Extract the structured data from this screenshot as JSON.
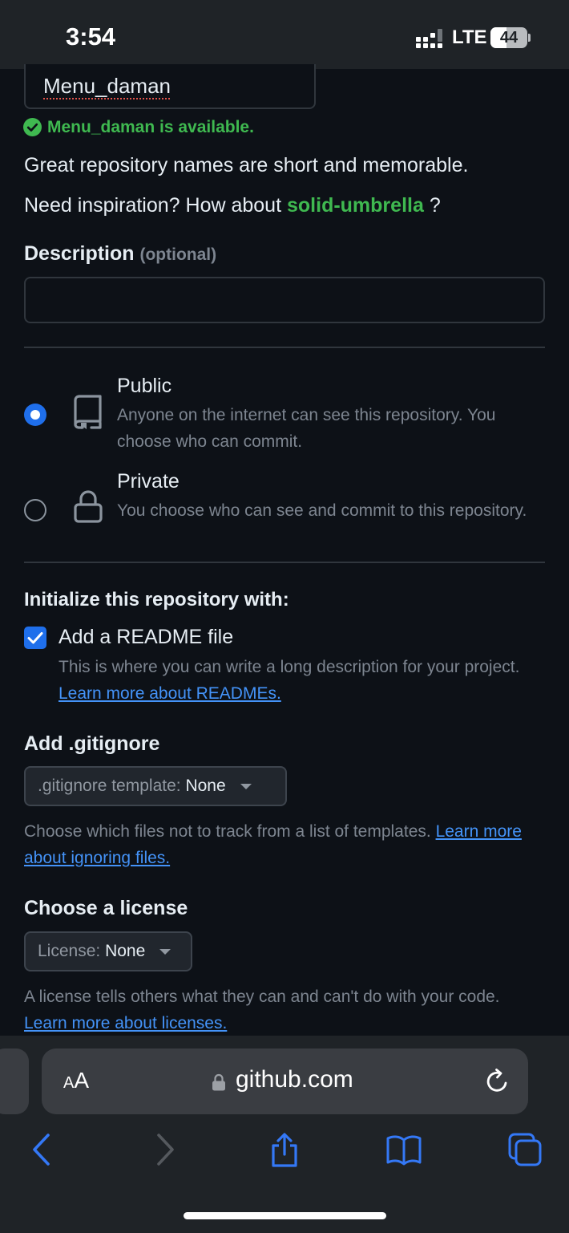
{
  "status_bar": {
    "time": "3:54",
    "network": "LTE",
    "battery": "44"
  },
  "repo_name": {
    "value": "Menu_daman",
    "availability": "Menu_daman is available."
  },
  "hints": {
    "short_memorable": "Great repository names are short and memorable.",
    "inspiration_prefix": "Need inspiration? How about",
    "suggestion": "solid-umbrella",
    "inspiration_suffix": "?"
  },
  "description": {
    "label": "Description",
    "optional": "(optional)",
    "value": ""
  },
  "visibility": {
    "selected": "public",
    "public": {
      "title": "Public",
      "desc": "Anyone on the internet can see this repository. You choose who can commit."
    },
    "private": {
      "title": "Private",
      "desc": "You choose who can see and commit to this repository."
    }
  },
  "initialize": {
    "heading": "Initialize this repository with:",
    "readme": {
      "label": "Add a README file",
      "checked": true,
      "desc": "This is where you can write a long description for your project.",
      "link": "Learn more about READMEs."
    }
  },
  "gitignore": {
    "heading": "Add .gitignore",
    "select_prefix": ".gitignore template:",
    "select_value": "None",
    "helper": "Choose which files not to track from a list of templates.",
    "link": "Learn more about ignoring files."
  },
  "license": {
    "heading": "Choose a license",
    "select_prefix": "License:",
    "select_value": "None",
    "helper": "A license tells others what they can and can't do with your code.",
    "link": "Learn more about licenses."
  },
  "browser": {
    "aa_big": "A",
    "aa_small": "A",
    "domain": "github.com",
    "accent": "#3478f6",
    "icons": [
      "back-icon",
      "forward-icon",
      "share-icon",
      "bookmarks-icon",
      "tabs-icon",
      "lock-icon",
      "reload-icon"
    ]
  },
  "colors": {
    "success": "#3fb950",
    "link": "#4493f8",
    "primary": "#1f6feb",
    "background": "#0d1117"
  }
}
